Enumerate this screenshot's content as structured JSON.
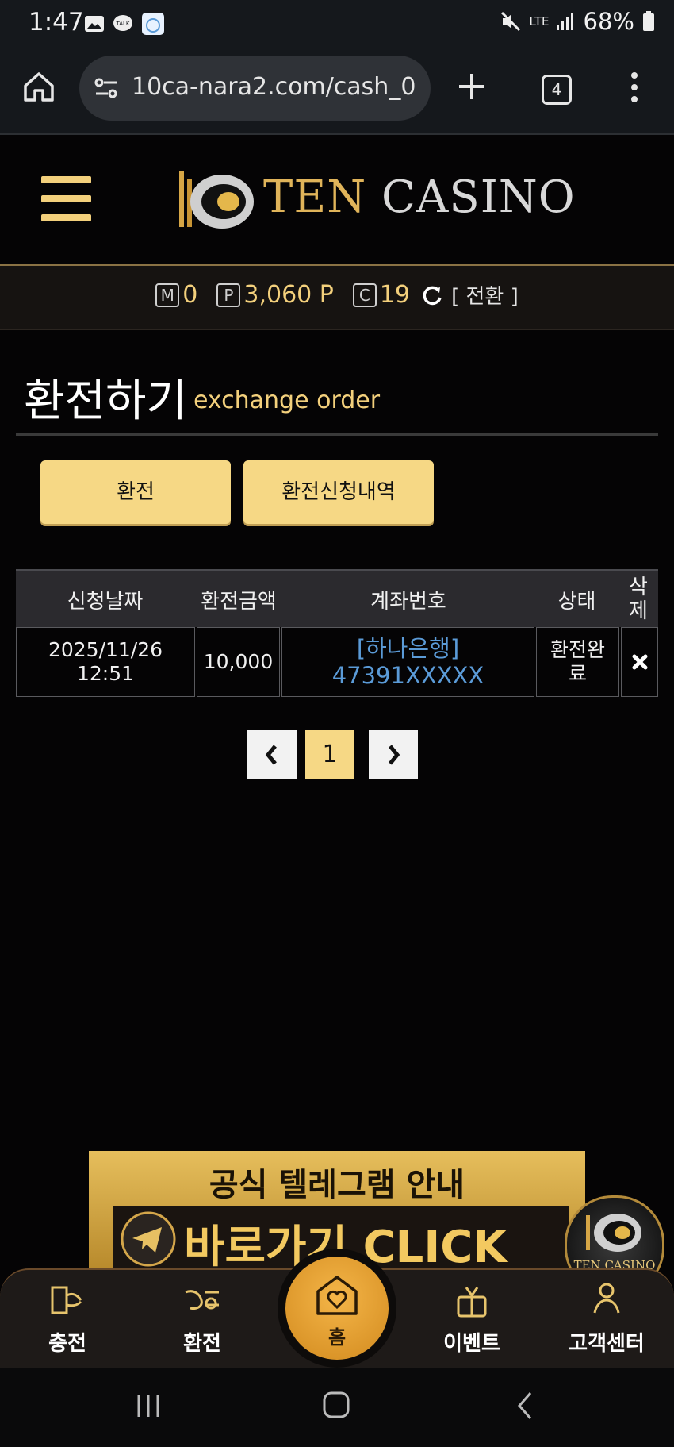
{
  "status_bar": {
    "time": "1:47",
    "battery": "68%",
    "network": "LTE"
  },
  "browser": {
    "url": "10ca-nara2.com/cash_0",
    "tab_count": "4"
  },
  "site": {
    "logo_ten": "TEN",
    "logo_casino": " CASINO"
  },
  "points": {
    "m_label": "M",
    "m_value": "0",
    "p_label": "P",
    "p_value": "3,060 P",
    "c_label": "C",
    "c_value": "19",
    "swap_label": "[ 전환 ]"
  },
  "page": {
    "title": "환전하기",
    "subtitle": "exchange order"
  },
  "tabs": [
    {
      "label": "환전"
    },
    {
      "label": "환전신청내역"
    }
  ],
  "table": {
    "headers": {
      "date": "신청날짜",
      "amount": "환전금액",
      "account": "계좌번호",
      "status": "상태",
      "delete": "삭제"
    },
    "rows": [
      {
        "date": "2025/11/26",
        "time": "12:51",
        "amount": "10,000",
        "bank": "[하나은행]",
        "account": "47391XXXXX",
        "status": "환전완료"
      }
    ]
  },
  "pagination": {
    "current": "1"
  },
  "banner": {
    "top_text": "공식 텔레그램 안내",
    "cta": "바로가기 CLICK"
  },
  "bottom_nav": {
    "charge": "충전",
    "exchange": "환전",
    "home": "홈",
    "event": "이벤트",
    "support": "고객센터"
  },
  "colors": {
    "accent": "#f6d885",
    "link": "#5b9bd8",
    "home": "#e9a534"
  }
}
